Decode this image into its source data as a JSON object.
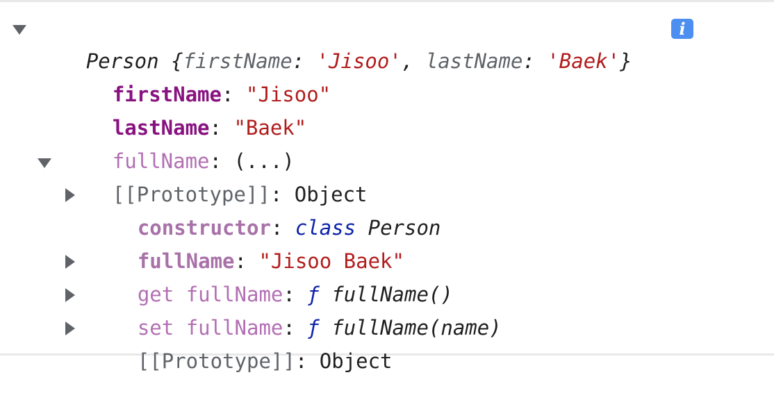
{
  "summary": {
    "class_name": "Person",
    "open_brace": " {",
    "first_key": "firstName",
    "first_value": "'Jisoo'",
    "sep": ", ",
    "last_key": "lastName",
    "last_value": "'Baek'",
    "close_brace": "}",
    "info_label": "i"
  },
  "own_props": [
    {
      "key": "firstName",
      "value": "\"Jisoo\""
    },
    {
      "key": "lastName",
      "value": "\"Baek\""
    },
    {
      "key": "fullName",
      "value": "(...)"
    }
  ],
  "prototype": {
    "label": "[[Prototype]]",
    "value": "Object",
    "constructor": {
      "key": "constructor",
      "keyword": "class",
      "name": "Person"
    },
    "full_name": {
      "key": "fullName",
      "value": "\"Jisoo Baek\""
    },
    "getter": {
      "prefix": "get ",
      "key": "fullName",
      "f": "ƒ",
      "sig": "fullName()"
    },
    "setter": {
      "prefix": "set ",
      "key": "fullName",
      "f": "ƒ",
      "sig": "fullName(name)"
    },
    "inner_proto": {
      "label": "[[Prototype]]",
      "value": "Object"
    }
  },
  "colon": ": "
}
